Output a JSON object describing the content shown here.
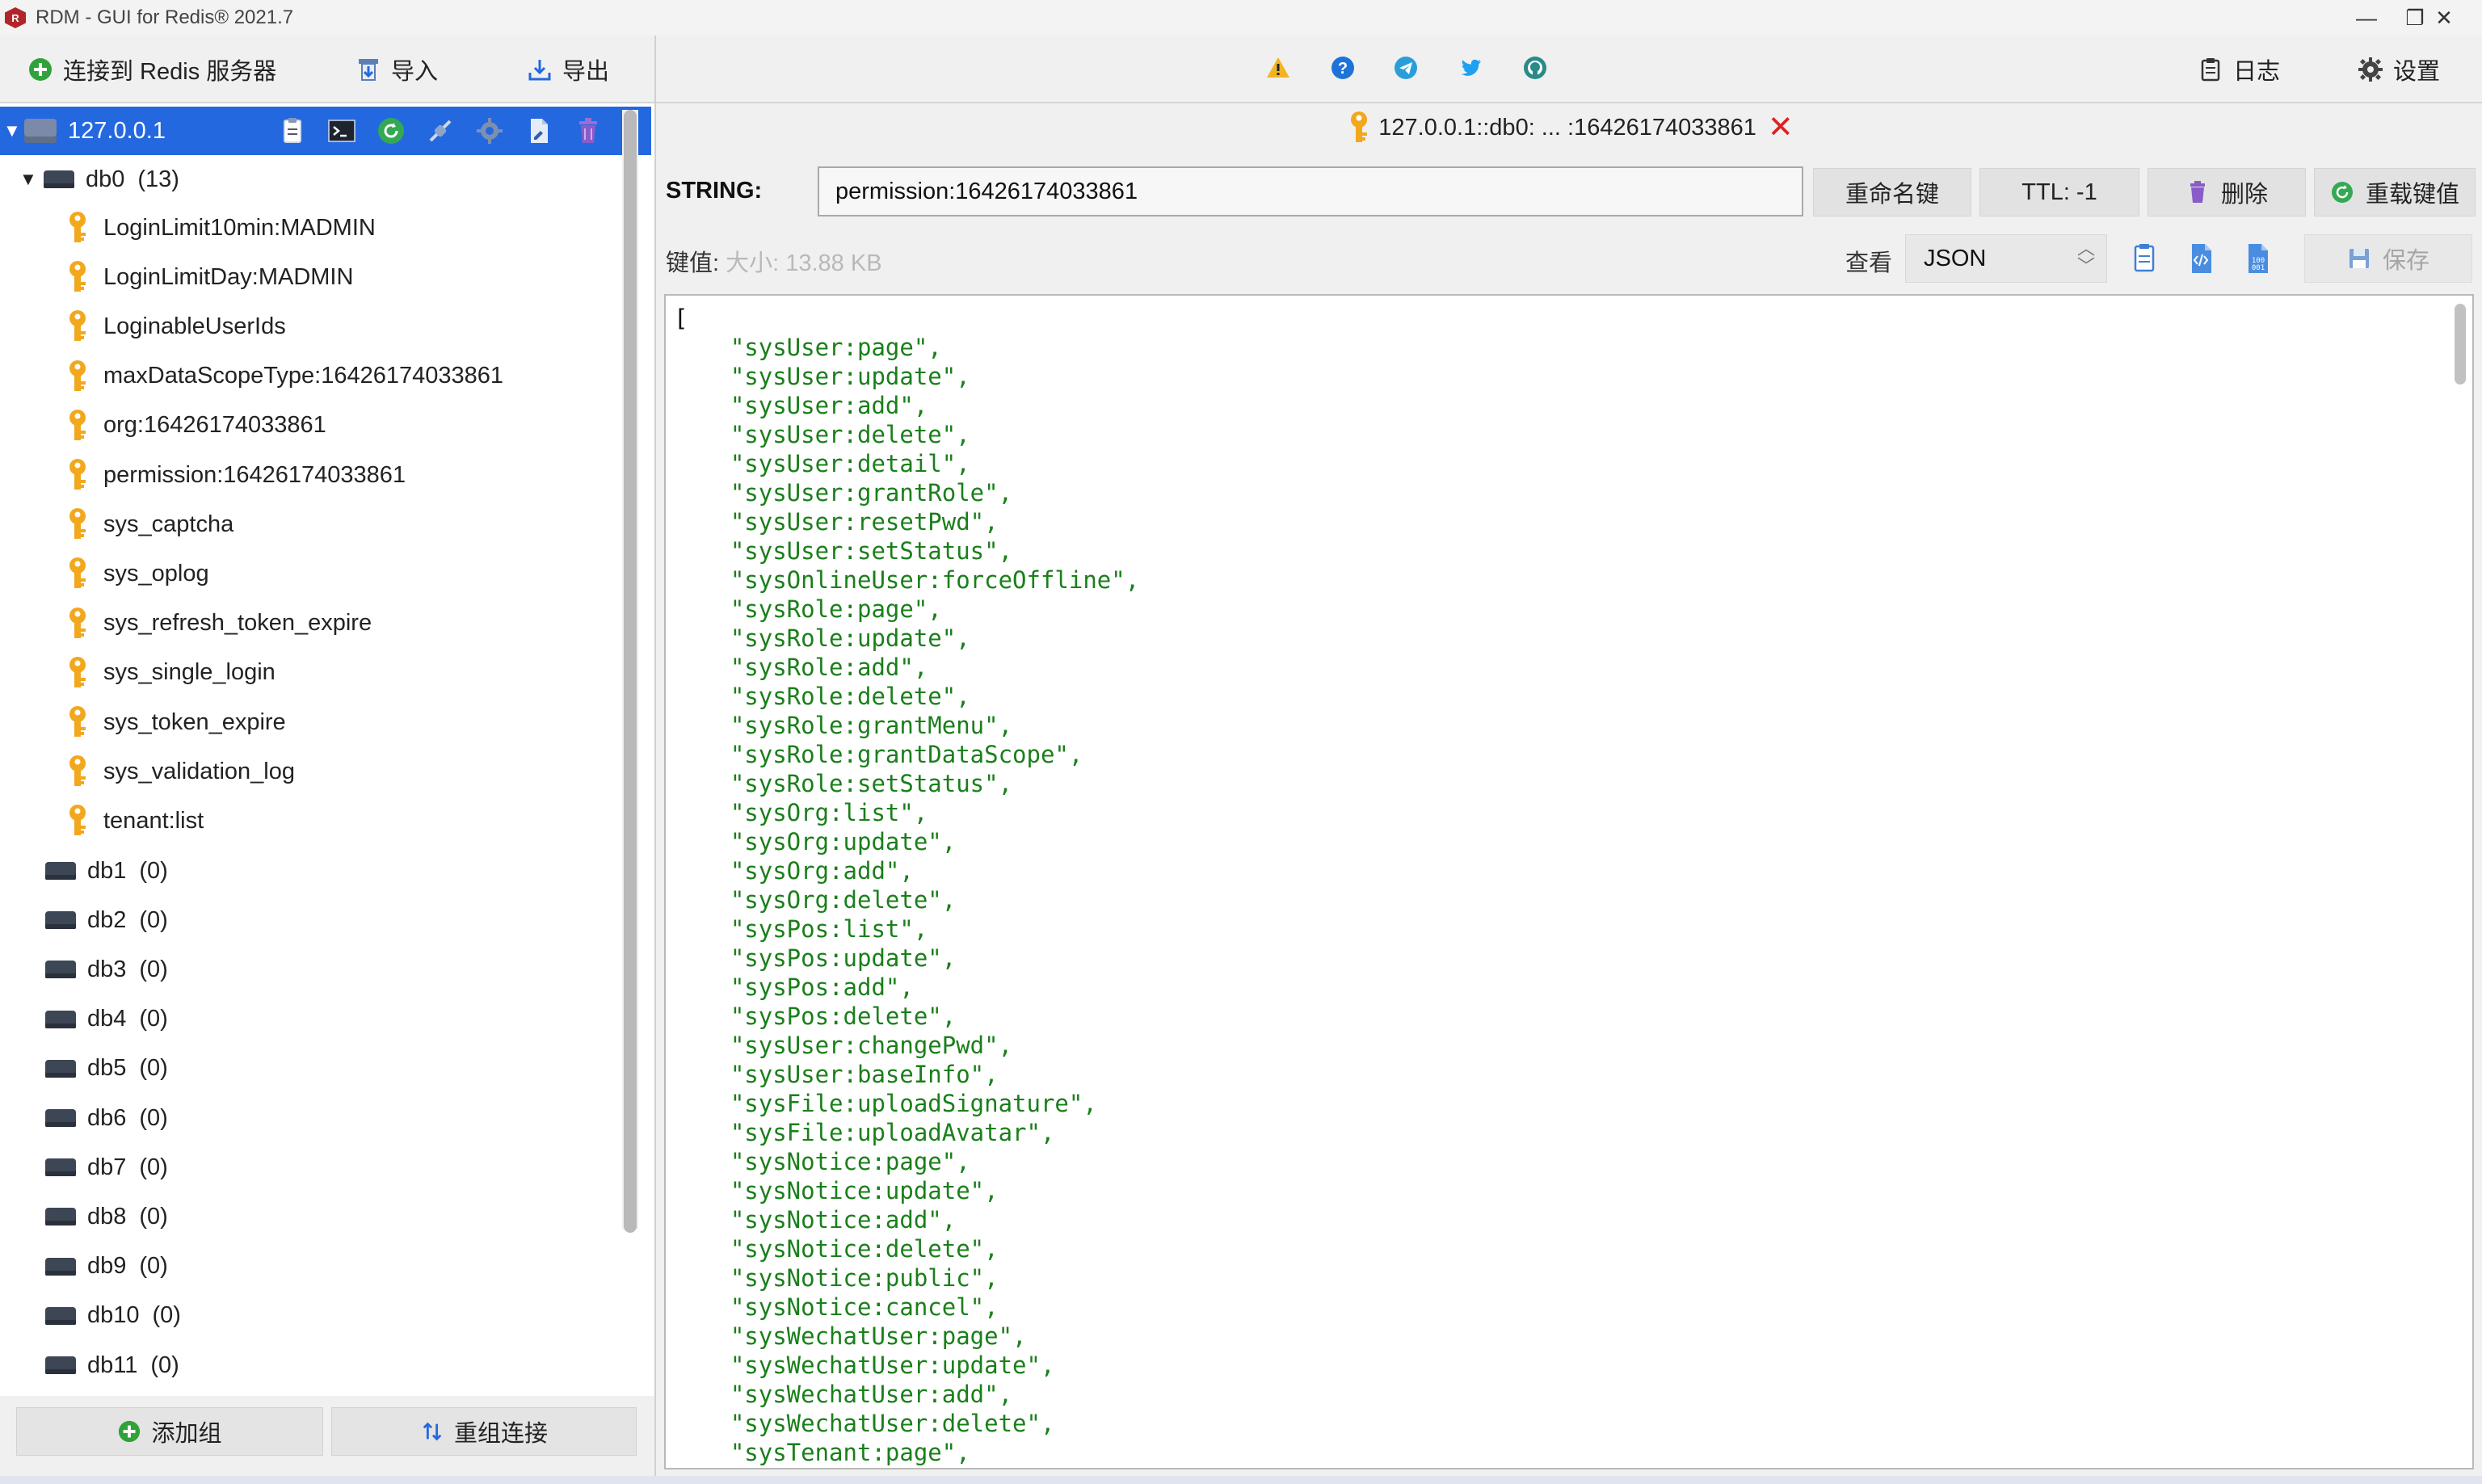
{
  "window": {
    "title": "RDM - GUI for Redis® 2021.7",
    "minimize": "—",
    "maximize": "❐",
    "close": "✕"
  },
  "toolbar": {
    "connect_label": "连接到 Redis 服务器",
    "import_label": "导入",
    "export_label": "导出",
    "log_label": "日志",
    "settings_label": "设置"
  },
  "server": {
    "name": "127.0.0.1"
  },
  "tree": {
    "db0": {
      "name": "db0",
      "count": "(13)"
    },
    "keys": [
      "LoginLimit10min:MADMIN",
      "LoginLimitDay:MADMIN",
      "LoginableUserIds",
      "maxDataScopeType:16426174033861",
      "org:16426174033861",
      "permission:16426174033861",
      "sys_captcha",
      "sys_oplog",
      "sys_refresh_token_expire",
      "sys_single_login",
      "sys_token_expire",
      "sys_validation_log",
      "tenant:list"
    ],
    "dbs": [
      {
        "name": "db1",
        "count": "(0)"
      },
      {
        "name": "db2",
        "count": "(0)"
      },
      {
        "name": "db3",
        "count": "(0)"
      },
      {
        "name": "db4",
        "count": "(0)"
      },
      {
        "name": "db5",
        "count": "(0)"
      },
      {
        "name": "db6",
        "count": "(0)"
      },
      {
        "name": "db7",
        "count": "(0)"
      },
      {
        "name": "db8",
        "count": "(0)"
      },
      {
        "name": "db9",
        "count": "(0)"
      },
      {
        "name": "db10",
        "count": "(0)"
      },
      {
        "name": "db11",
        "count": "(0)"
      }
    ]
  },
  "left_bottom": {
    "add_group": "添加组",
    "regroup": "重组连接"
  },
  "tab": {
    "title": "127.0.0.1::db0: ... :16426174033861"
  },
  "key_panel": {
    "type": "STRING:",
    "key_name": "permission:16426174033861",
    "rename": "重命名键",
    "ttl": "TTL:  -1",
    "delete": "删除",
    "reload": "重载键值",
    "value_label": "键值:",
    "size_label": "大小:  13.88 KB",
    "view_label": "查看",
    "view_mode": "JSON",
    "save": "保存"
  },
  "value": {
    "open": "[",
    "items": [
      "\"sysUser:page\",",
      "\"sysUser:update\",",
      "\"sysUser:add\",",
      "\"sysUser:delete\",",
      "\"sysUser:detail\",",
      "\"sysUser:grantRole\",",
      "\"sysUser:resetPwd\",",
      "\"sysUser:setStatus\",",
      "\"sysOnlineUser:forceOffline\",",
      "\"sysRole:page\",",
      "\"sysRole:update\",",
      "\"sysRole:add\",",
      "\"sysRole:delete\",",
      "\"sysRole:grantMenu\",",
      "\"sysRole:grantDataScope\",",
      "\"sysRole:setStatus\",",
      "\"sysOrg:list\",",
      "\"sysOrg:update\",",
      "\"sysOrg:add\",",
      "\"sysOrg:delete\",",
      "\"sysPos:list\",",
      "\"sysPos:update\",",
      "\"sysPos:add\",",
      "\"sysPos:delete\",",
      "\"sysUser:changePwd\",",
      "\"sysUser:baseInfo\",",
      "\"sysFile:uploadSignature\",",
      "\"sysFile:uploadAvatar\",",
      "\"sysNotice:page\",",
      "\"sysNotice:update\",",
      "\"sysNotice:add\",",
      "\"sysNotice:delete\",",
      "\"sysNotice:public\",",
      "\"sysNotice:cancel\",",
      "\"sysWechatUser:page\",",
      "\"sysWechatUser:update\",",
      "\"sysWechatUser:add\",",
      "\"sysWechatUser:delete\",",
      "\"sysTenant:page\","
    ]
  },
  "colors": {
    "selection": "#2468e0",
    "string": "#1a7f1a",
    "key_icon": "#f2a81d"
  }
}
